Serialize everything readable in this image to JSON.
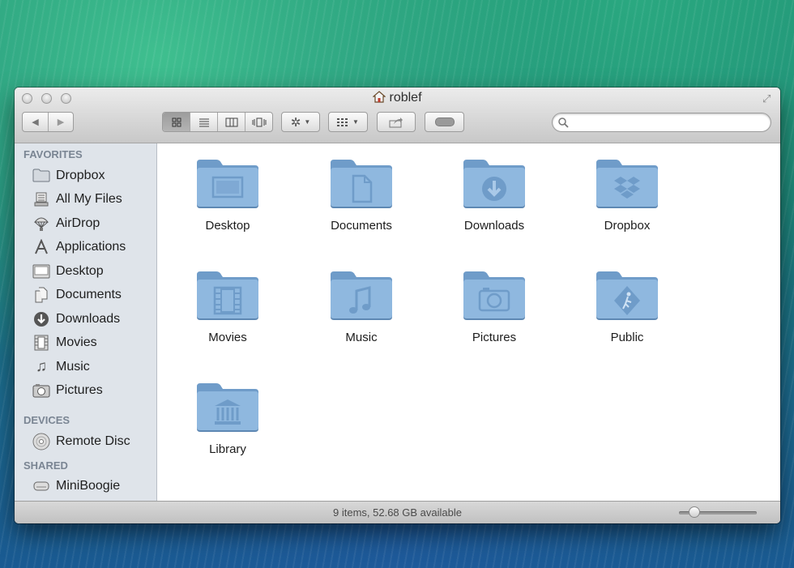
{
  "window": {
    "title": "roblef"
  },
  "toolbar": {
    "back_label": "◀",
    "forward_label": "▶",
    "search": {
      "value": "",
      "placeholder": ""
    }
  },
  "sidebar": {
    "sections": [
      {
        "label": "FAVORITES",
        "items": [
          {
            "label": "Dropbox",
            "icon": "folder-icon"
          },
          {
            "label": "All My Files",
            "icon": "all-files-icon"
          },
          {
            "label": "AirDrop",
            "icon": "airdrop-icon"
          },
          {
            "label": "Applications",
            "icon": "applications-icon"
          },
          {
            "label": "Desktop",
            "icon": "desktop-icon"
          },
          {
            "label": "Documents",
            "icon": "documents-icon"
          },
          {
            "label": "Downloads",
            "icon": "downloads-icon"
          },
          {
            "label": "Movies",
            "icon": "movies-icon"
          },
          {
            "label": "Music",
            "icon": "music-icon"
          },
          {
            "label": "Pictures",
            "icon": "pictures-icon"
          }
        ]
      },
      {
        "label": "DEVICES",
        "items": [
          {
            "label": "Remote Disc",
            "icon": "disc-icon"
          }
        ]
      },
      {
        "label": "SHARED",
        "items": [
          {
            "label": "MiniBoogie",
            "icon": "network-computer-icon"
          }
        ]
      }
    ]
  },
  "content": {
    "folders": [
      {
        "label": "Desktop",
        "icon": "desktop-folder-icon"
      },
      {
        "label": "Documents",
        "icon": "documents-folder-icon"
      },
      {
        "label": "Downloads",
        "icon": "downloads-folder-icon"
      },
      {
        "label": "Dropbox",
        "icon": "dropbox-folder-icon"
      },
      {
        "label": "Movies",
        "icon": "movies-folder-icon"
      },
      {
        "label": "Music",
        "icon": "music-folder-icon"
      },
      {
        "label": "Pictures",
        "icon": "pictures-folder-icon"
      },
      {
        "label": "Public",
        "icon": "public-folder-icon"
      },
      {
        "label": "Library",
        "icon": "library-folder-icon"
      }
    ]
  },
  "status": {
    "text": "9 items, 52.68 GB available",
    "icon_size_level": 0.2
  },
  "colors": {
    "folder": "#8fb8df",
    "folder_dark": "#6f9cc9",
    "sidebar": "#dfe4ea"
  }
}
